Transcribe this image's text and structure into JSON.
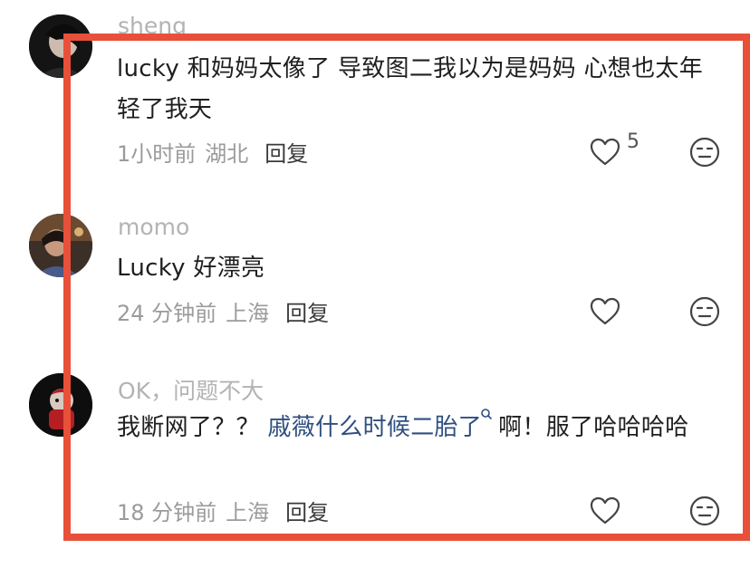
{
  "comments": [
    {
      "username": "sheng",
      "text": "lucky 和妈妈太像了 导致图二我以为是妈妈 心想也太年轻了我天",
      "time": "1小时前",
      "location": "湖北",
      "reply": "回复",
      "likes": "5"
    },
    {
      "username": "momo",
      "text": "Lucky 好漂亮",
      "time": "24 分钟前",
      "location": "上海",
      "reply": "回复",
      "likes": ""
    },
    {
      "username": "OK，问题不大",
      "text_before": "我断网了？？",
      "link": "戚薇什么时候二胎了",
      "text_after": "啊！服了哈哈哈哈",
      "time": "18 分钟前",
      "location": "上海",
      "reply": "回复",
      "likes": ""
    }
  ],
  "colors": {
    "highlight_border": "#e8503a",
    "link": "#2f4f7f",
    "meta": "#9b9b9b",
    "username": "#b3b3b3"
  },
  "icons": [
    "heart-outline-icon",
    "neutral-face-emoji-icon",
    "search-icon"
  ]
}
